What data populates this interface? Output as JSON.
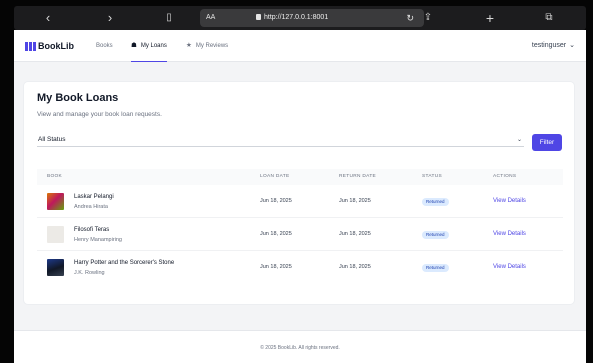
{
  "browser": {
    "address_aa": "AA",
    "url": "http://127.0.0.1:8001"
  },
  "nav": {
    "brand": "BookLib",
    "items": [
      {
        "label": "Books"
      },
      {
        "label": "My Loans"
      },
      {
        "label": "My Reviews"
      }
    ],
    "user": "testinguser"
  },
  "page": {
    "title": "My Book Loans",
    "subtitle": "View and manage your book loan requests."
  },
  "filter": {
    "status_value": "All Status",
    "button_label": "Filter"
  },
  "table": {
    "headers": [
      "BOOK",
      "LOAN DATE",
      "RETURN DATE",
      "STATUS",
      "ACTIONS"
    ],
    "rows": [
      {
        "title": "Laskar Pelangi",
        "author": "Andrea Hirata",
        "loan_date": "Jun 18, 2025",
        "return_date": "Jun 18, 2025",
        "status": "Returned",
        "action": "View Details"
      },
      {
        "title": "Filosofi Teras",
        "author": "Henry Manampiring",
        "loan_date": "Jun 18, 2025",
        "return_date": "Jun 18, 2025",
        "status": "Returned",
        "action": "View Details"
      },
      {
        "title": "Harry Potter and the Sorcerer's Stone",
        "author": "J.K. Rowling",
        "loan_date": "Jun 18, 2025",
        "return_date": "Jun 18, 2025",
        "status": "Returned",
        "action": "View Details"
      }
    ]
  },
  "footer": {
    "text": "© 2025 BookLib. All rights reserved."
  },
  "colors": {
    "accent": "#4f46e5",
    "badge_bg": "#dbeafe",
    "badge_text": "#1e40af"
  },
  "icons": [
    "back-icon",
    "forward-icon",
    "book-icon",
    "lock-icon",
    "reload-icon",
    "share-icon",
    "plus-icon",
    "tabs-icon",
    "loans-icon",
    "star-icon",
    "chevron-down-icon"
  ]
}
